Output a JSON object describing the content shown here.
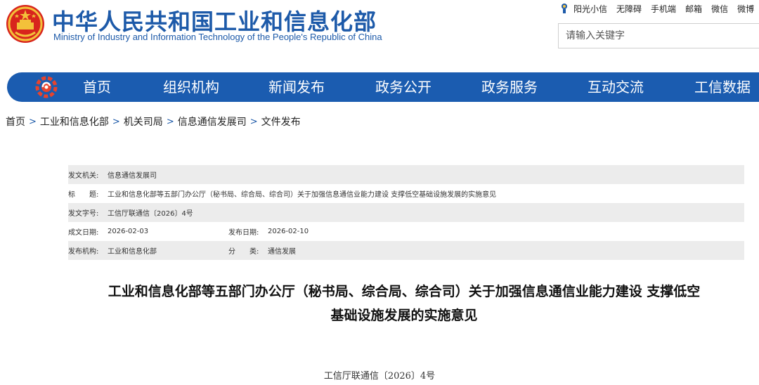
{
  "header": {
    "title_cn": "中华人民共和国工业和信息化部",
    "title_en": "Ministry of Industry and Information Technology of the People's Republic of China"
  },
  "top_links": [
    "阳光小信",
    "无障碍",
    "手机端",
    "邮箱",
    "微信",
    "微博"
  ],
  "search": {
    "placeholder": "请输入关键字"
  },
  "nav": {
    "items": [
      "首页",
      "组织机构",
      "新闻发布",
      "政务公开",
      "政务服务",
      "互动交流",
      "工信数据"
    ],
    "color": "#1b5cb0"
  },
  "breadcrumb": [
    "首页",
    "工业和信息化部",
    "机关司局",
    "信息通信发展司",
    "文件发布"
  ],
  "info": {
    "issuer_label": "发文机关:",
    "issuer": "信息通信发展司",
    "title_label": "标　　题:",
    "title": "工业和信息化部等五部门办公厅（秘书局、综合局、综合司）关于加强信息通信业能力建设 支撑低空基础设施发展的实施意见",
    "doc_no_label": "发文字号:",
    "doc_no": "工信厅联通信〔2026〕4号",
    "created_label": "成文日期:",
    "created": "2026-02-03",
    "published_label": "发布日期:",
    "published": "2026-02-10",
    "org_label": "发布机构:",
    "org": "工业和信息化部",
    "category_label": "分　　类:",
    "category": "通信发展"
  },
  "document": {
    "title_line1": "工业和信息化部等五部门办公厅（秘书局、综合局、综合司）关于加强信息通信业能力建设 支撑低空",
    "title_line2": "基础设施发展的实施意见",
    "doc_number": "工信厅联通信〔2026〕4号"
  },
  "icons": {
    "emblem": "national-emblem-icon",
    "nav_logo": "miit-logo-icon",
    "top_link": "sun-mascot-icon"
  },
  "colors": {
    "brand_blue": "#1d5aa9",
    "info_shade": "#ececec"
  }
}
